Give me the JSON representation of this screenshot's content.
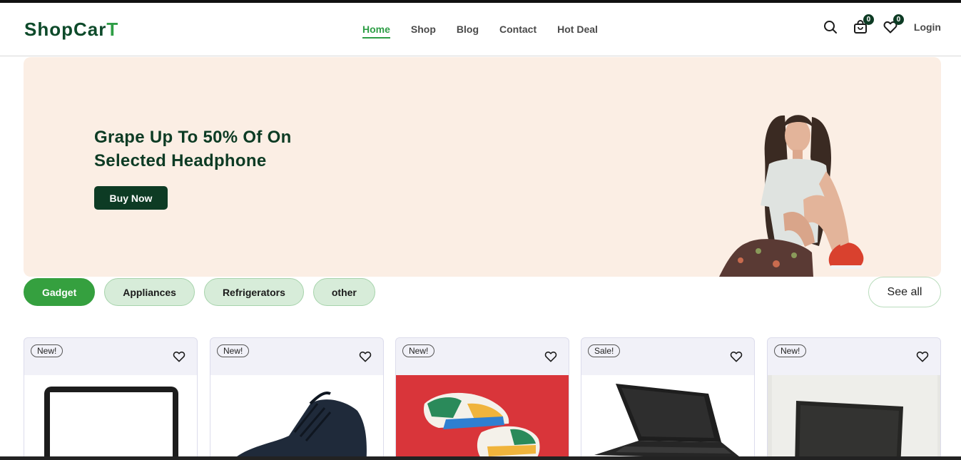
{
  "header": {
    "logo_main": "ShopCar",
    "logo_accent": "T",
    "nav": [
      {
        "label": "Home",
        "active": true
      },
      {
        "label": "Shop",
        "active": false
      },
      {
        "label": "Blog",
        "active": false
      },
      {
        "label": "Contact",
        "active": false
      },
      {
        "label": "Hot Deal",
        "active": false
      }
    ],
    "cart_count": "0",
    "wishlist_count": "0",
    "login_label": "Login",
    "icons": [
      "search-icon",
      "shopping-bag-icon",
      "heart-icon"
    ]
  },
  "hero": {
    "headline_line1": "Grape Up To 50% Of On",
    "headline_line2": "Selected Headphone",
    "button_label": "Buy Now"
  },
  "categories": {
    "items": [
      {
        "label": "Gadget",
        "active": true
      },
      {
        "label": "Appliances",
        "active": false
      },
      {
        "label": "Refrigerators",
        "active": false
      },
      {
        "label": "other",
        "active": false
      }
    ],
    "see_all_label": "See all"
  },
  "products": [
    {
      "tag": "New!",
      "image": "tablet"
    },
    {
      "tag": "New!",
      "image": "sneaker-boot"
    },
    {
      "tag": "New!",
      "image": "colorful-sneakers"
    },
    {
      "tag": "Sale!",
      "image": "laptop"
    },
    {
      "tag": "New!",
      "image": "monitor"
    }
  ],
  "colors": {
    "brand_dark": "#0d3b24",
    "brand_green": "#35a03f",
    "hero_bg": "#fbeee4",
    "chip_bg": "#d7ecd9"
  }
}
